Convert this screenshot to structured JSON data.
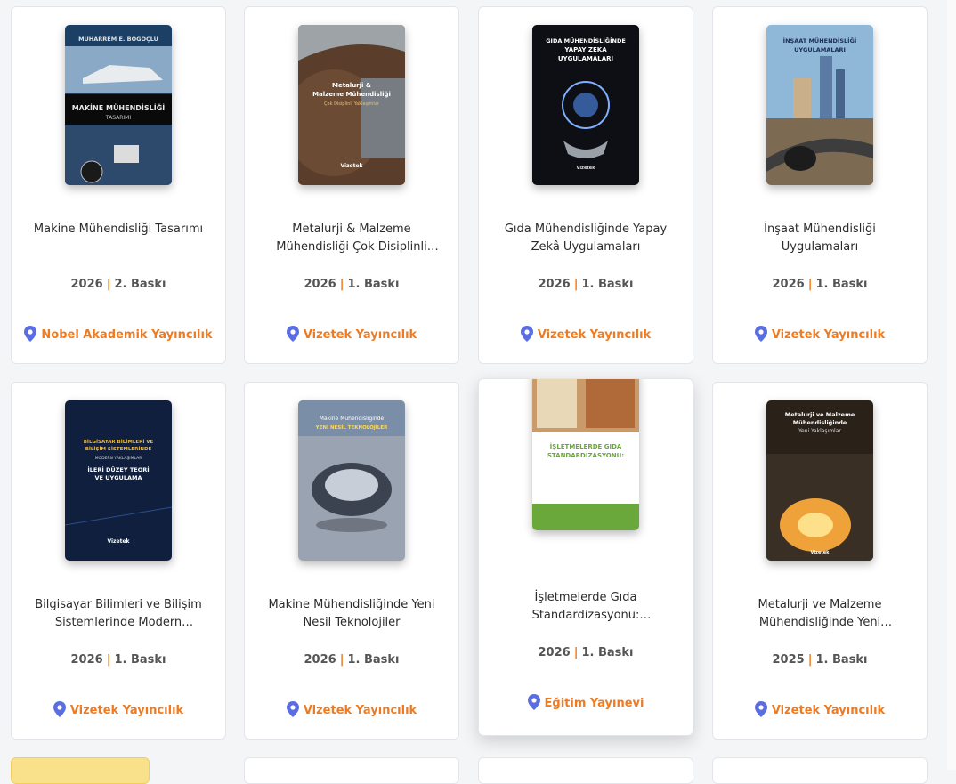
{
  "books": [
    {
      "title": "Makine Mühendisliği Tasarımı",
      "year": "2026",
      "edition": "2. Baskı",
      "publisher": "Nobel Akademik Yayıncılık",
      "cover": {
        "bg": "#1c3f66",
        "accent": "#d9d9d9",
        "lines": [
          "MUHARREM E. BOĞOÇLU",
          "MAKİNE MÜHENDİSLİĞİ",
          "TASARIMI"
        ]
      }
    },
    {
      "title": "Metalurji & Malzeme Mühendisliği Çok Disiplinli Yaklaşımlar",
      "year": "2026",
      "edition": "1. Baskı",
      "publisher": "Vizetek Yayıncılık",
      "cover": {
        "bg": "#5a3e2b",
        "accent": "#e9c06a",
        "lines": [
          "Metalurji &",
          "Malzeme Mühendisliği",
          "Çok Disiplinli Yaklaşımlar",
          "Vizetek"
        ]
      }
    },
    {
      "title": "Gıda Mühendisliğinde Yapay Zekâ Uygulamaları",
      "year": "2026",
      "edition": "1. Baskı",
      "publisher": "Vizetek Yayıncılık",
      "cover": {
        "bg": "#0d0f14",
        "accent": "#7fb0ff",
        "lines": [
          "GIDA MÜHENDİSLİĞİNDE",
          "YAPAY ZEKA",
          "UYGULAMALARI",
          "Vizetek"
        ]
      }
    },
    {
      "title": "İnşaat Mühendisliği Uygulamaları",
      "year": "2026",
      "edition": "1. Baskı",
      "publisher": "Vizetek Yayıncılık",
      "cover": {
        "bg": "#8fb8d8",
        "accent": "#1e2e55",
        "lines": [
          "İNŞAAT MÜHENDİSLİĞİ",
          "UYGULAMALARI"
        ]
      }
    },
    {
      "title": "Bilgisayar Bilimleri ve Bilişim Sistemlerinde Modern Yaklaşımla...",
      "year": "2026",
      "edition": "1. Baskı",
      "publisher": "Vizetek Yayıncılık",
      "cover": {
        "bg": "#0f1f3d",
        "accent": "#e6b84a",
        "lines": [
          "BİLGİSAYAR BİLİMLERİ VE",
          "BİLİŞİM SİSTEMLERİNDE",
          "MODERN YAKLAŞIMLAR",
          "İLERİ DÜZEY TEORİ",
          "VE UYGULAMA",
          "Vizetek"
        ]
      }
    },
    {
      "title": "Makine Mühendisliğinde Yeni Nesil Teknolojiler",
      "year": "2026",
      "edition": "1. Baskı",
      "publisher": "Vizetek Yayıncılık",
      "cover": {
        "bg": "#9aa3b2",
        "accent": "#ffd95a",
        "lines": [
          "Makine Mühendisliğinde",
          "YENİ NESİL TEKNOLOJİLER"
        ]
      }
    },
    {
      "title": "İşletmelerde Gıda Standardizasyonu: Kavramsal,...",
      "year": "2026",
      "edition": "1. Baskı",
      "publisher": "Eğitim Yayınevi",
      "cover": {
        "bg": "#ffffff",
        "accent": "#6aa83b",
        "lines": [
          "İŞLETMELERDE GIDA",
          "STANDARDİZASYONU:"
        ]
      }
    },
    {
      "title": "Metalurji ve Malzeme Mühendisliğinde Yeni Yaklaşımlar",
      "year": "2025",
      "edition": "1. Baskı",
      "publisher": "Vizetek Yayıncılık",
      "cover": {
        "bg": "#2a2118",
        "accent": "#f0a23a",
        "lines": [
          "Metalurji ve Malzeme",
          "Mühendisliğinde",
          "Yeni Yaklaşımlar",
          "Vizetek"
        ]
      }
    }
  ],
  "colors": {
    "accent": "#ee7b22",
    "pin": "#5b6ee1"
  }
}
